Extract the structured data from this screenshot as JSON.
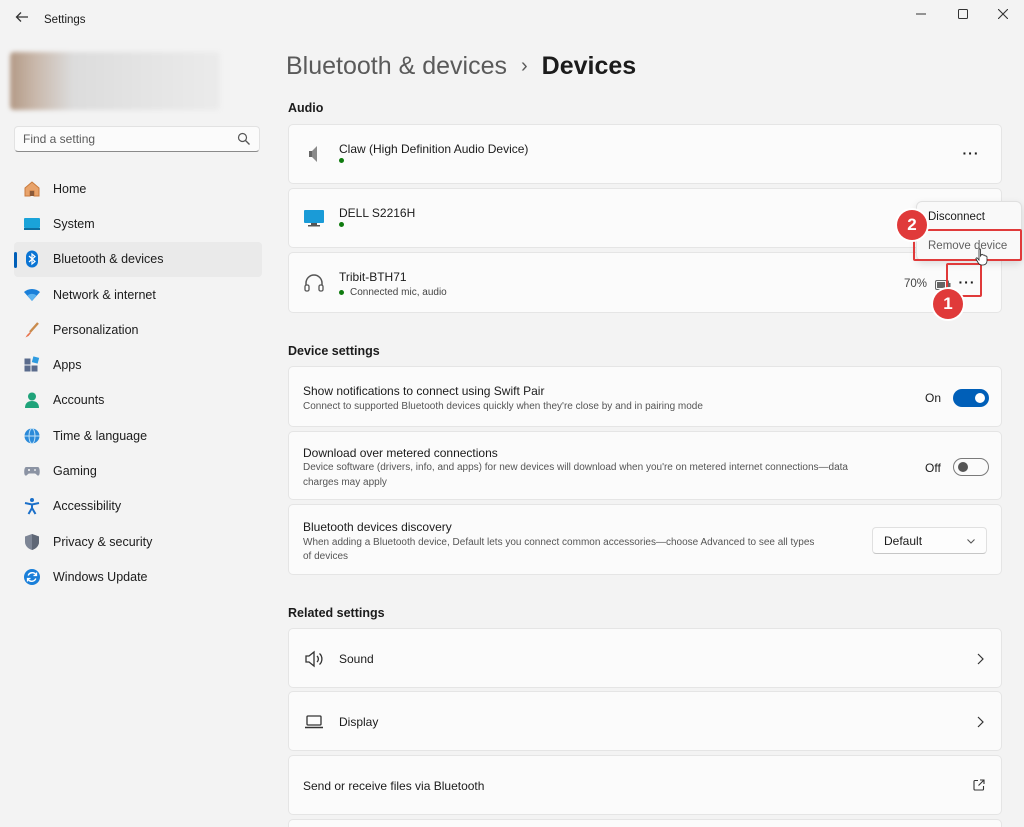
{
  "window": {
    "back_icon": "arrow-left-icon",
    "title": "Settings",
    "controls": [
      "minimize-icon",
      "maximize-icon",
      "close-icon"
    ]
  },
  "sidebar": {
    "search": {
      "placeholder": "Find a setting",
      "icon": "search-icon"
    },
    "items": [
      {
        "label": "Home",
        "icon": "home-icon",
        "active": false
      },
      {
        "label": "System",
        "icon": "system-icon",
        "active": false
      },
      {
        "label": "Bluetooth & devices",
        "icon": "bluetooth-icon",
        "active": true
      },
      {
        "label": "Network & internet",
        "icon": "wifi-icon",
        "active": false
      },
      {
        "label": "Personalization",
        "icon": "brush-icon",
        "active": false
      },
      {
        "label": "Apps",
        "icon": "apps-icon",
        "active": false
      },
      {
        "label": "Accounts",
        "icon": "person-icon",
        "active": false
      },
      {
        "label": "Time & language",
        "icon": "globe-clock-icon",
        "active": false
      },
      {
        "label": "Gaming",
        "icon": "gamepad-icon",
        "active": false
      },
      {
        "label": "Accessibility",
        "icon": "accessibility-icon",
        "active": false
      },
      {
        "label": "Privacy & security",
        "icon": "shield-icon",
        "active": false
      },
      {
        "label": "Windows Update",
        "icon": "update-icon",
        "active": false
      }
    ]
  },
  "breadcrumb": {
    "parent": "Bluetooth & devices",
    "separator": "›",
    "current": "Devices"
  },
  "audio": {
    "title": "Audio",
    "devices": [
      {
        "name": "Claw (High Definition Audio Device)",
        "status": "",
        "icon": "speaker-icon",
        "more": "···"
      },
      {
        "name": "DELL S2216H",
        "status": "",
        "icon": "monitor-icon"
      },
      {
        "name": "Tribit-BTH71",
        "status": "Connected mic, audio",
        "icon": "headphones-icon",
        "battery": "70%",
        "more": "···"
      }
    ]
  },
  "context_menu": {
    "items": [
      "Disconnect",
      "Remove device"
    ]
  },
  "annotations": {
    "badge_1": "1",
    "badge_2": "2",
    "highlight_color": "#e03a3a"
  },
  "device_settings": {
    "title": "Device settings",
    "swift_pair": {
      "title": "Show notifications to connect using Swift Pair",
      "description": "Connect to supported Bluetooth devices quickly when they're close by and in pairing mode",
      "state": "On"
    },
    "metered": {
      "title": "Download over metered connections",
      "description_line1": "Device software (drivers, info, and apps) for new devices will download when you're on metered internet connections—data",
      "description_line2": "charges may apply",
      "state": "Off"
    },
    "discovery": {
      "title": "Bluetooth devices discovery",
      "description_line1": "When adding a Bluetooth device, Default lets you connect common accessories—choose Advanced to see all types",
      "description_line2": "of devices",
      "selected": "Default"
    }
  },
  "related": {
    "title": "Related settings",
    "items": [
      {
        "label": "Sound",
        "icon": "speaker-volume-icon",
        "action": "chevron-right-icon"
      },
      {
        "label": "Display",
        "icon": "laptop-icon",
        "action": "chevron-right-icon"
      },
      {
        "label": "Send or receive files via Bluetooth",
        "icon": "",
        "action": "external-link-icon"
      }
    ]
  },
  "colors": {
    "accent": "#005fb8",
    "status_green": "#0f7b0f",
    "annotation_red": "#e03a3a"
  }
}
